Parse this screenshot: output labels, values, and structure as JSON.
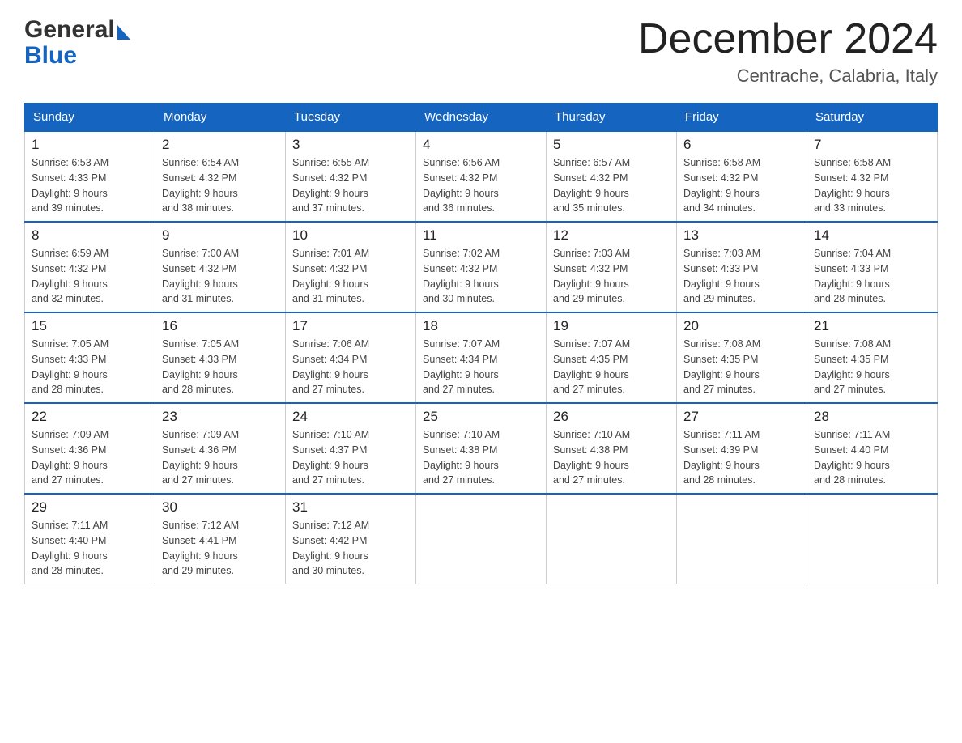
{
  "header": {
    "month_year": "December 2024",
    "location": "Centrache, Calabria, Italy",
    "logo_general": "General",
    "logo_blue": "Blue"
  },
  "days_of_week": [
    "Sunday",
    "Monday",
    "Tuesday",
    "Wednesday",
    "Thursday",
    "Friday",
    "Saturday"
  ],
  "weeks": [
    [
      {
        "day": "1",
        "sunrise": "Sunrise: 6:53 AM",
        "sunset": "Sunset: 4:33 PM",
        "daylight": "Daylight: 9 hours",
        "daylight2": "and 39 minutes."
      },
      {
        "day": "2",
        "sunrise": "Sunrise: 6:54 AM",
        "sunset": "Sunset: 4:32 PM",
        "daylight": "Daylight: 9 hours",
        "daylight2": "and 38 minutes."
      },
      {
        "day": "3",
        "sunrise": "Sunrise: 6:55 AM",
        "sunset": "Sunset: 4:32 PM",
        "daylight": "Daylight: 9 hours",
        "daylight2": "and 37 minutes."
      },
      {
        "day": "4",
        "sunrise": "Sunrise: 6:56 AM",
        "sunset": "Sunset: 4:32 PM",
        "daylight": "Daylight: 9 hours",
        "daylight2": "and 36 minutes."
      },
      {
        "day": "5",
        "sunrise": "Sunrise: 6:57 AM",
        "sunset": "Sunset: 4:32 PM",
        "daylight": "Daylight: 9 hours",
        "daylight2": "and 35 minutes."
      },
      {
        "day": "6",
        "sunrise": "Sunrise: 6:58 AM",
        "sunset": "Sunset: 4:32 PM",
        "daylight": "Daylight: 9 hours",
        "daylight2": "and 34 minutes."
      },
      {
        "day": "7",
        "sunrise": "Sunrise: 6:58 AM",
        "sunset": "Sunset: 4:32 PM",
        "daylight": "Daylight: 9 hours",
        "daylight2": "and 33 minutes."
      }
    ],
    [
      {
        "day": "8",
        "sunrise": "Sunrise: 6:59 AM",
        "sunset": "Sunset: 4:32 PM",
        "daylight": "Daylight: 9 hours",
        "daylight2": "and 32 minutes."
      },
      {
        "day": "9",
        "sunrise": "Sunrise: 7:00 AM",
        "sunset": "Sunset: 4:32 PM",
        "daylight": "Daylight: 9 hours",
        "daylight2": "and 31 minutes."
      },
      {
        "day": "10",
        "sunrise": "Sunrise: 7:01 AM",
        "sunset": "Sunset: 4:32 PM",
        "daylight": "Daylight: 9 hours",
        "daylight2": "and 31 minutes."
      },
      {
        "day": "11",
        "sunrise": "Sunrise: 7:02 AM",
        "sunset": "Sunset: 4:32 PM",
        "daylight": "Daylight: 9 hours",
        "daylight2": "and 30 minutes."
      },
      {
        "day": "12",
        "sunrise": "Sunrise: 7:03 AM",
        "sunset": "Sunset: 4:32 PM",
        "daylight": "Daylight: 9 hours",
        "daylight2": "and 29 minutes."
      },
      {
        "day": "13",
        "sunrise": "Sunrise: 7:03 AM",
        "sunset": "Sunset: 4:33 PM",
        "daylight": "Daylight: 9 hours",
        "daylight2": "and 29 minutes."
      },
      {
        "day": "14",
        "sunrise": "Sunrise: 7:04 AM",
        "sunset": "Sunset: 4:33 PM",
        "daylight": "Daylight: 9 hours",
        "daylight2": "and 28 minutes."
      }
    ],
    [
      {
        "day": "15",
        "sunrise": "Sunrise: 7:05 AM",
        "sunset": "Sunset: 4:33 PM",
        "daylight": "Daylight: 9 hours",
        "daylight2": "and 28 minutes."
      },
      {
        "day": "16",
        "sunrise": "Sunrise: 7:05 AM",
        "sunset": "Sunset: 4:33 PM",
        "daylight": "Daylight: 9 hours",
        "daylight2": "and 28 minutes."
      },
      {
        "day": "17",
        "sunrise": "Sunrise: 7:06 AM",
        "sunset": "Sunset: 4:34 PM",
        "daylight": "Daylight: 9 hours",
        "daylight2": "and 27 minutes."
      },
      {
        "day": "18",
        "sunrise": "Sunrise: 7:07 AM",
        "sunset": "Sunset: 4:34 PM",
        "daylight": "Daylight: 9 hours",
        "daylight2": "and 27 minutes."
      },
      {
        "day": "19",
        "sunrise": "Sunrise: 7:07 AM",
        "sunset": "Sunset: 4:35 PM",
        "daylight": "Daylight: 9 hours",
        "daylight2": "and 27 minutes."
      },
      {
        "day": "20",
        "sunrise": "Sunrise: 7:08 AM",
        "sunset": "Sunset: 4:35 PM",
        "daylight": "Daylight: 9 hours",
        "daylight2": "and 27 minutes."
      },
      {
        "day": "21",
        "sunrise": "Sunrise: 7:08 AM",
        "sunset": "Sunset: 4:35 PM",
        "daylight": "Daylight: 9 hours",
        "daylight2": "and 27 minutes."
      }
    ],
    [
      {
        "day": "22",
        "sunrise": "Sunrise: 7:09 AM",
        "sunset": "Sunset: 4:36 PM",
        "daylight": "Daylight: 9 hours",
        "daylight2": "and 27 minutes."
      },
      {
        "day": "23",
        "sunrise": "Sunrise: 7:09 AM",
        "sunset": "Sunset: 4:36 PM",
        "daylight": "Daylight: 9 hours",
        "daylight2": "and 27 minutes."
      },
      {
        "day": "24",
        "sunrise": "Sunrise: 7:10 AM",
        "sunset": "Sunset: 4:37 PM",
        "daylight": "Daylight: 9 hours",
        "daylight2": "and 27 minutes."
      },
      {
        "day": "25",
        "sunrise": "Sunrise: 7:10 AM",
        "sunset": "Sunset: 4:38 PM",
        "daylight": "Daylight: 9 hours",
        "daylight2": "and 27 minutes."
      },
      {
        "day": "26",
        "sunrise": "Sunrise: 7:10 AM",
        "sunset": "Sunset: 4:38 PM",
        "daylight": "Daylight: 9 hours",
        "daylight2": "and 27 minutes."
      },
      {
        "day": "27",
        "sunrise": "Sunrise: 7:11 AM",
        "sunset": "Sunset: 4:39 PM",
        "daylight": "Daylight: 9 hours",
        "daylight2": "and 28 minutes."
      },
      {
        "day": "28",
        "sunrise": "Sunrise: 7:11 AM",
        "sunset": "Sunset: 4:40 PM",
        "daylight": "Daylight: 9 hours",
        "daylight2": "and 28 minutes."
      }
    ],
    [
      {
        "day": "29",
        "sunrise": "Sunrise: 7:11 AM",
        "sunset": "Sunset: 4:40 PM",
        "daylight": "Daylight: 9 hours",
        "daylight2": "and 28 minutes."
      },
      {
        "day": "30",
        "sunrise": "Sunrise: 7:12 AM",
        "sunset": "Sunset: 4:41 PM",
        "daylight": "Daylight: 9 hours",
        "daylight2": "and 29 minutes."
      },
      {
        "day": "31",
        "sunrise": "Sunrise: 7:12 AM",
        "sunset": "Sunset: 4:42 PM",
        "daylight": "Daylight: 9 hours",
        "daylight2": "and 30 minutes."
      },
      null,
      null,
      null,
      null
    ]
  ]
}
